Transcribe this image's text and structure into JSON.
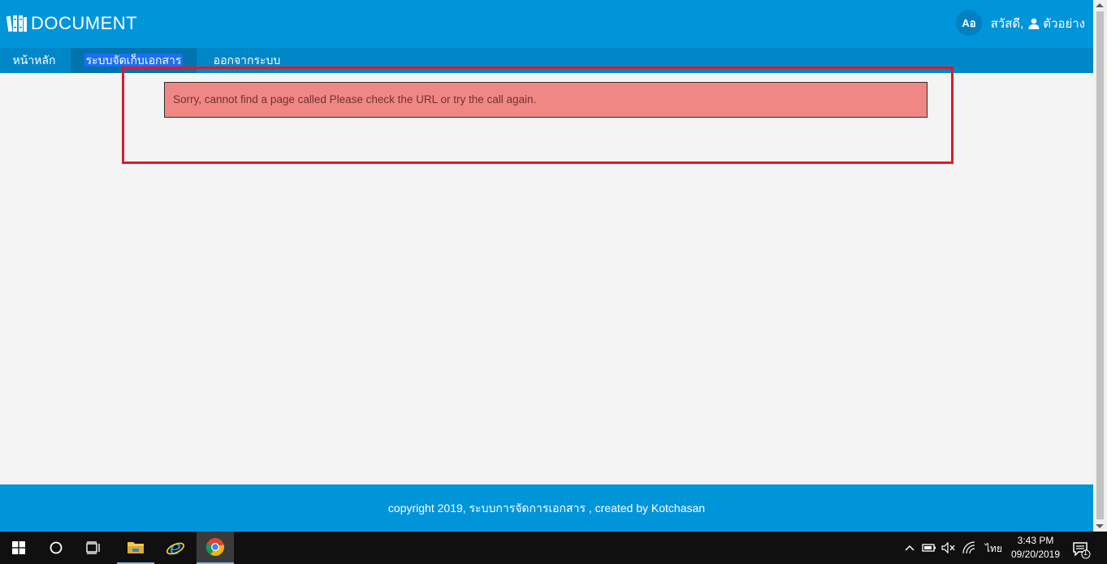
{
  "header": {
    "brand": "DOCUMENT",
    "lang_button": "Aอ",
    "greeting": "สวัสดี,",
    "username": "ตัวอย่าง"
  },
  "nav": {
    "home": "หน้าหลัก",
    "docs": "ระบบจัดเก็บเอกสาร",
    "logout": "ออกจากระบบ"
  },
  "alert": {
    "message": "Sorry, cannot find a page called Please check the URL or try the call again."
  },
  "footer": {
    "text": "copyright 2019, ระบบการจัดการเอกสาร , created by Kotchasan"
  },
  "taskbar": {
    "language": "ไทย",
    "time": "3:43 PM",
    "date": "09/20/2019",
    "notification_count": "1"
  },
  "colors": {
    "header_bg": "#0095d9",
    "nav_bg": "#0187c7",
    "alert_bg": "#f18785",
    "highlight_border": "#e0192a",
    "taskbar_bg": "#101010"
  },
  "icons": {
    "logo": "books-icon",
    "user": "user-icon",
    "start": "windows-start-icon",
    "search": "cortana-circle-icon",
    "task_view": "task-view-icon",
    "explorer": "file-explorer-icon",
    "ie": "internet-explorer-icon",
    "chrome": "chrome-icon"
  }
}
